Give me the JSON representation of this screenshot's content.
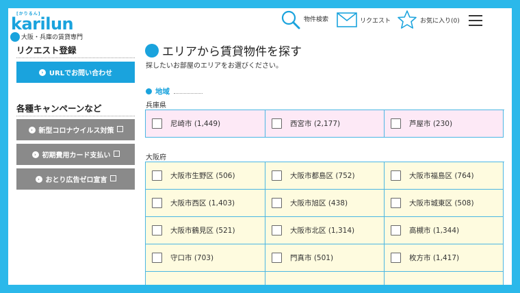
{
  "header": {
    "logo_sub": "[かりるん]",
    "logo_text": "karilun",
    "tagline": "大阪・兵庫の賃貸専門",
    "search_label": "物件検索",
    "request_label": "リクエスト",
    "favorite_label": "お気に入り(0)"
  },
  "sidebar": {
    "request_title": "リクエスト登録",
    "url_button": "URLでお問い合わせ",
    "campaign_title": "各種キャンペーンなど",
    "campaign_buttons": [
      "新型コロナウイルス対策",
      "初期費用カード支払い",
      "おとり広告ゼロ宣言"
    ]
  },
  "main": {
    "title": "エリアから賃貸物件を探す",
    "subtitle": "探したいお部屋のエリアをお選びください。",
    "area_heading": "地域",
    "hyogo": {
      "label": "兵庫県",
      "cities": [
        "尼崎市 (1,449)",
        "西宮市 (2,177)",
        "芦屋市 (230)"
      ]
    },
    "osaka": {
      "label": "大阪府",
      "rows": [
        [
          "大阪市生野区 (506)",
          "大阪市都島区 (752)",
          "大阪市福島区 (764)"
        ],
        [
          "大阪市西区 (1,403)",
          "大阪市旭区 (438)",
          "大阪市城東区 (508)"
        ],
        [
          "大阪市鶴見区 (521)",
          "大阪市北区 (1,314)",
          "高槻市 (1,344)"
        ],
        [
          "守口市 (703)",
          "門真市 (501)",
          "枚方市 (1,417)"
        ]
      ]
    }
  },
  "colors": {
    "frame": "#2bb8ea",
    "accent": "#1aa3dd",
    "pink_cell": "#fde9f6",
    "yellow_cell": "#fefbdf",
    "gray_button": "#8a8a8a"
  }
}
